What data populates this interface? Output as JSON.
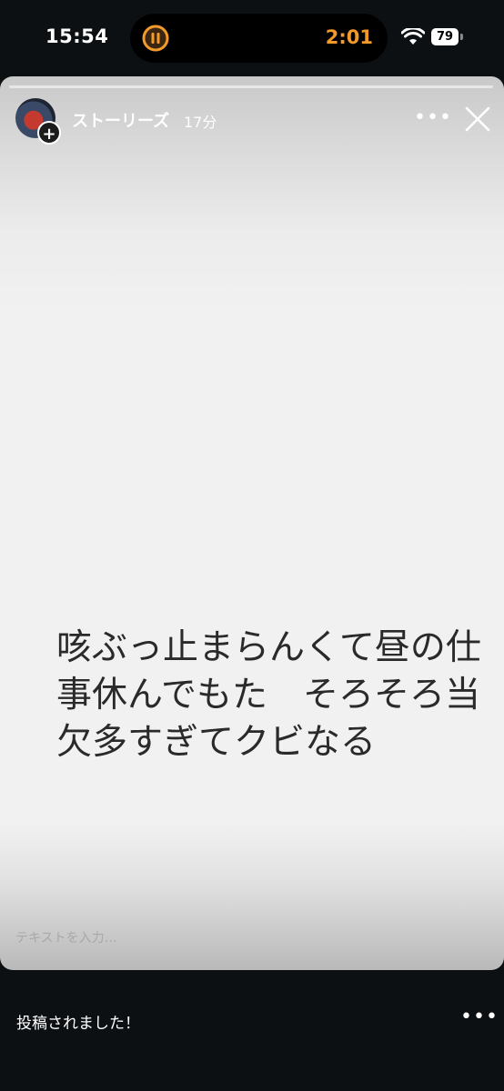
{
  "status_bar": {
    "time": "15:54",
    "timer": "2:01",
    "battery": "79"
  },
  "story": {
    "title": "ストーリーズ",
    "time_ago": "17分",
    "text": "咳ぶっ止まらんくて昼の仕事休んでもた　そろそろ当欠多すぎてクビなる",
    "input_placeholder": "テキストを入力…"
  },
  "footer": {
    "message": "投稿されました！"
  },
  "icons": {
    "more": "•••",
    "add": "+",
    "close": "close-icon",
    "wifi": "wifi-icon",
    "timer": "pause-timer-icon"
  },
  "colors": {
    "timer_accent": "#f39a2b",
    "background": "#0d1013"
  }
}
